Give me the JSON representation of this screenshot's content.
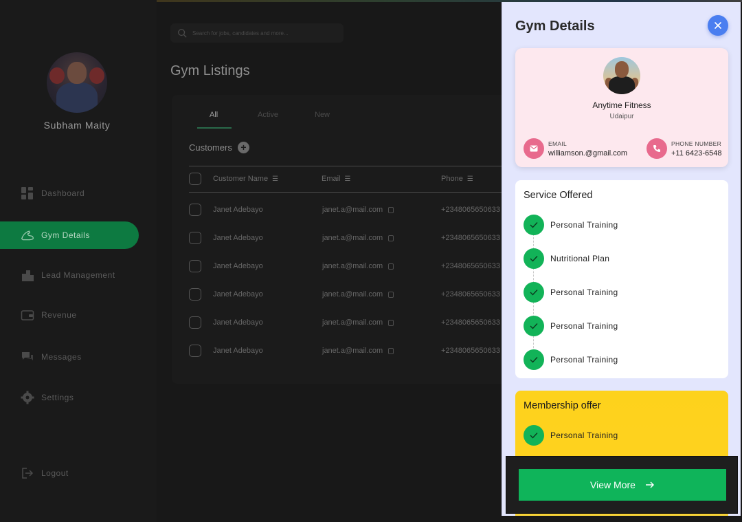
{
  "user": {
    "name": "Subham Maity"
  },
  "nav": {
    "items": [
      {
        "label": "Dashboard",
        "icon": "dashboard-icon"
      },
      {
        "label": "Gym Details",
        "icon": "muscle-icon"
      },
      {
        "label": "Lead Management",
        "icon": "building-icon"
      },
      {
        "label": "Revenue",
        "icon": "wallet-icon"
      },
      {
        "label": "Messages",
        "icon": "chat-icon"
      },
      {
        "label": "Settings",
        "icon": "gear-icon"
      },
      {
        "label": "Logout",
        "icon": "logout-icon"
      }
    ],
    "active_index": 1
  },
  "search": {
    "placeholder": "Search for jobs, candidates and more..."
  },
  "page": {
    "title": "Gym Listings"
  },
  "tabs": [
    {
      "label": "All"
    },
    {
      "label": "Active"
    },
    {
      "label": "New"
    }
  ],
  "customers": {
    "title": "Customers",
    "columns": [
      "Customer Name",
      "Email",
      "Phone"
    ],
    "rows": [
      {
        "name": "Janet Adebayo",
        "email": "janet.a@mail.com",
        "phone": "+2348065650633"
      },
      {
        "name": "Janet Adebayo",
        "email": "janet.a@mail.com",
        "phone": "+2348065650633"
      },
      {
        "name": "Janet Adebayo",
        "email": "janet.a@mail.com",
        "phone": "+2348065650633"
      },
      {
        "name": "Janet Adebayo",
        "email": "janet.a@mail.com",
        "phone": "+2348065650633"
      },
      {
        "name": "Janet Adebayo",
        "email": "janet.a@mail.com",
        "phone": "+2348065650633"
      },
      {
        "name": "Janet Adebayo",
        "email": "janet.a@mail.com",
        "phone": "+2348065650633"
      }
    ]
  },
  "drawer": {
    "title": "Gym Details",
    "gym": {
      "name": "Anytime Fitness",
      "city": "Udaipur",
      "email_label": "EMAIL",
      "email": "williamson.@gmail.com",
      "phone_label": "PHONE NUMBER",
      "phone": "+11 6423-6548"
    },
    "services": {
      "heading": "Service Offered",
      "items": [
        "Personal Training",
        "Nutritional Plan",
        "Personal Training",
        "Personal Training",
        "Personal Training"
      ]
    },
    "membership": {
      "heading": "Membership offer",
      "items": [
        "Personal Training"
      ]
    },
    "view_more_label": "View More",
    "colors": {
      "accent_green": "#12b358",
      "close_blue": "#4a7ef0",
      "contact_pink": "#e86a8d",
      "membership_yellow": "#fdd21c"
    }
  }
}
